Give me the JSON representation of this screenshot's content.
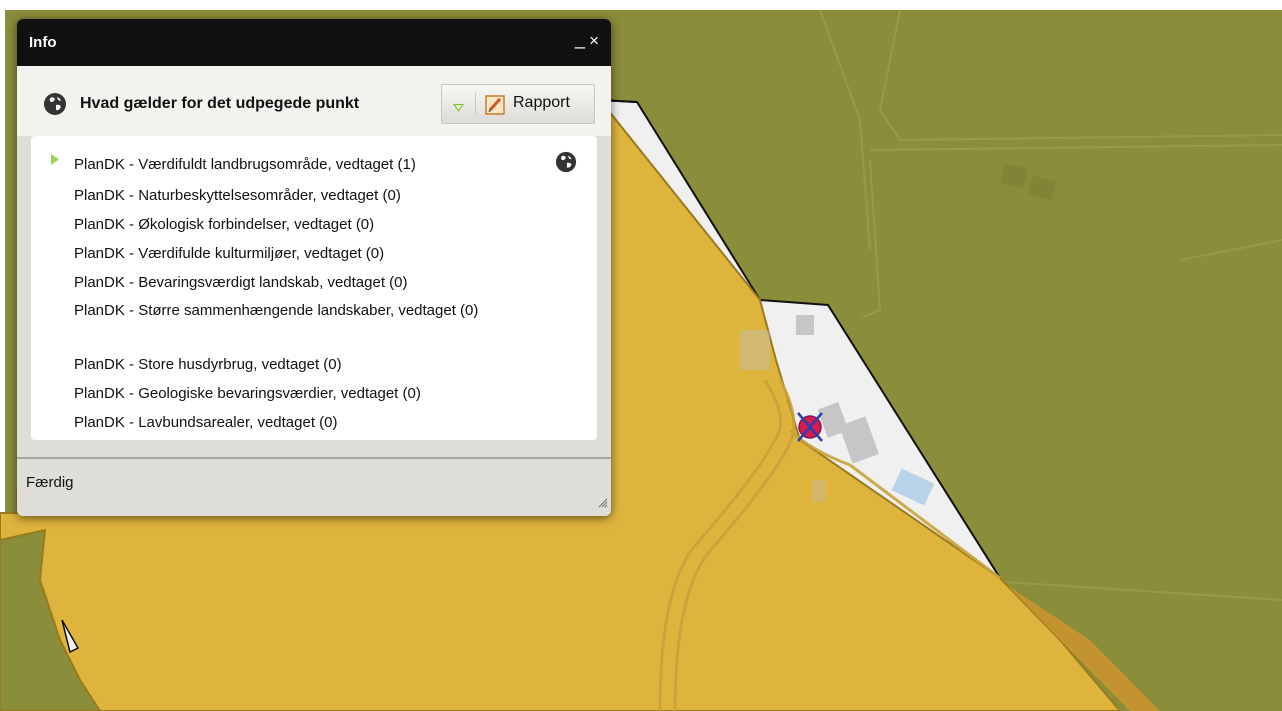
{
  "window": {
    "title": "Info",
    "minimize_symbol": "_",
    "close_symbol": "×"
  },
  "header": {
    "heading": "Hvad gælder for det udpegede punkt",
    "report_label": "Rapport"
  },
  "list": {
    "items": [
      "PlanDK - Værdifuldt landbrugsområde, vedtaget (1)",
      "PlanDK - Naturbeskyttelsesområder, vedtaget (0)",
      "PlanDK - Økologisk forbindelser, vedtaget (0)",
      "PlanDK - Værdifulde kulturmiljøer, vedtaget (0)",
      "PlanDK - Bevaringsværdigt landskab, vedtaget (0)",
      "PlanDK - Større sammenhængende landskaber, vedtaget (0)",
      "PlanDK - Store husdyrbrug, vedtaget (0)",
      "PlanDK - Geologiske bevaringsværdier, vedtaget (0)",
      "PlanDK - Lavbundsarealer, vedtaget (0)"
    ]
  },
  "footer": {
    "status": "Færdig"
  },
  "icons": {
    "header": "globe-icon",
    "expand": "triangle-down-icon",
    "report": "notepad-pencil-icon",
    "row": "triangle-right-icon",
    "row_action": "globe-icon",
    "marker": "crosshair-marker-icon"
  },
  "colors": {
    "map_green": "#8a8d3a",
    "map_yellow": "#dfb43d",
    "map_parcel": "#f0f0f0",
    "marker": "#d81b4a"
  }
}
